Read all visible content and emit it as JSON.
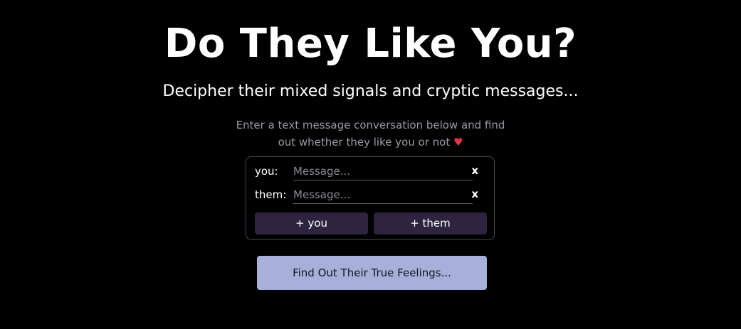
{
  "header": {
    "title": "Do They Like You?",
    "subtitle": "Decipher their mixed signals and cryptic messages...",
    "instructions_line1": "Enter a text message conversation below and find",
    "instructions_line2": "out whether they like you or not",
    "heart_glyph": "♥"
  },
  "conversation": {
    "messages": [
      {
        "speaker": "you:",
        "value": "",
        "placeholder": "Message...",
        "remove_label": "x"
      },
      {
        "speaker": "them:",
        "value": "",
        "placeholder": "Message...",
        "remove_label": "x"
      }
    ],
    "add_you_label": "+ you",
    "add_them_label": "+ them"
  },
  "submit": {
    "label": "Find Out Their True Feelings..."
  },
  "colors": {
    "background": "#000000",
    "add_button": "#2e2440",
    "submit_button": "#a7b0d8",
    "heart": "#e3324a"
  }
}
